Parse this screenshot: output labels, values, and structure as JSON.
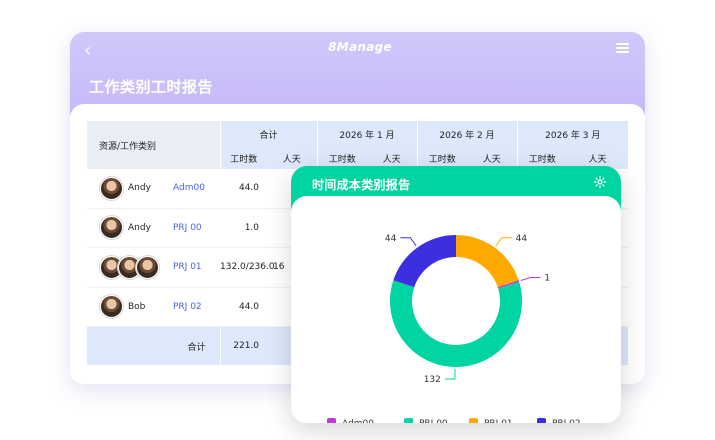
{
  "app": {
    "brand": "8Manage",
    "page_title": "工作类别工时报告"
  },
  "table": {
    "corner_label": "资源/工作类别",
    "groups": [
      "合计",
      "2026 年 1 月",
      "2026 年 2 月",
      "2026 年 3 月"
    ],
    "subheaders": [
      "工时数",
      "人天",
      "工时数",
      "人天",
      "工时数",
      "人天",
      "工时数",
      "人天"
    ],
    "rows": [
      {
        "resource": "Andy",
        "category": "Adm00",
        "hours": "44.0",
        "days": ""
      },
      {
        "resource": "Andy",
        "category": "PRJ 00",
        "hours": "1.0",
        "days": ""
      },
      {
        "resource": "",
        "category": "PRJ 01",
        "hours": "132.0/236.0",
        "days": "16"
      },
      {
        "resource": "Bob",
        "category": "PRJ 02",
        "hours": "44.0",
        "days": ""
      }
    ],
    "total_label": "合计",
    "total_hours": "221.0"
  },
  "modal": {
    "title": "时间成本类别报告"
  },
  "chart_data": {
    "type": "pie",
    "donut": true,
    "categories": [
      "Adm00",
      "PRJ 00",
      "PRJ 01",
      "PRJ 02"
    ],
    "values": [
      1,
      132,
      44,
      44
    ],
    "colors": [
      "#c23bd4",
      "#00d4a0",
      "#ffa800",
      "#3b2fe0"
    ],
    "legend": "bottom"
  }
}
